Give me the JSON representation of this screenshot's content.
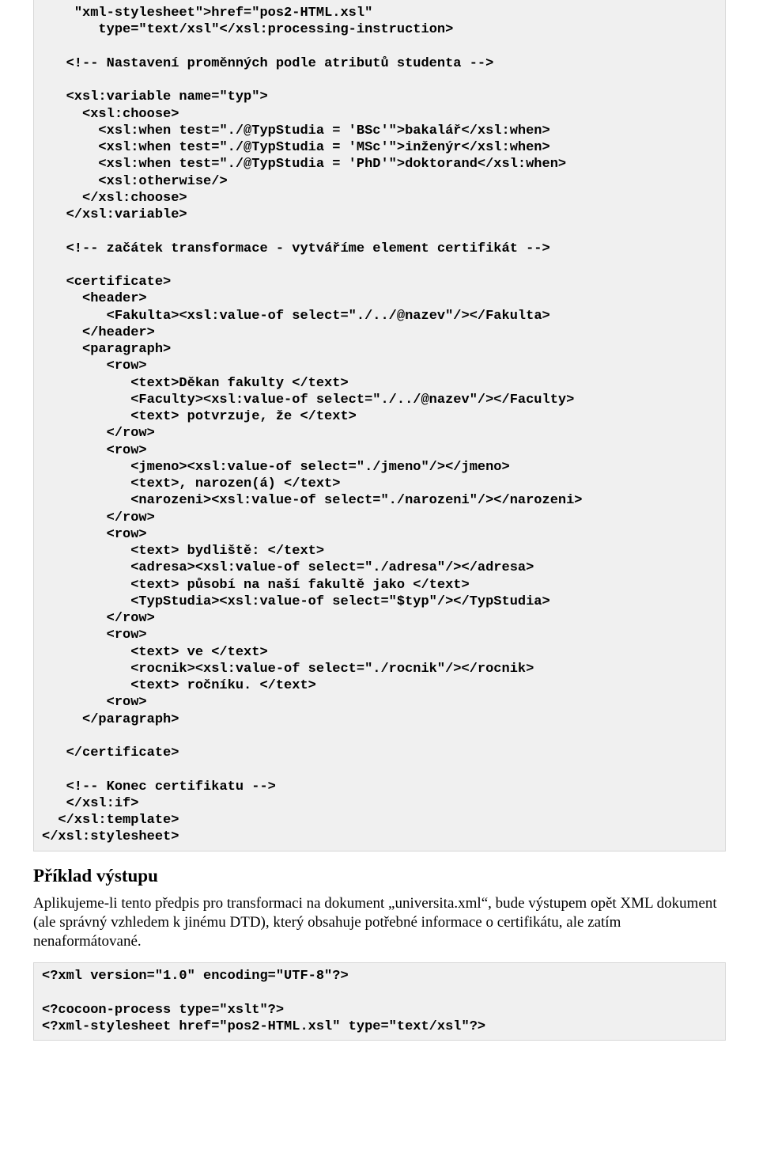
{
  "code1": "    \"xml-stylesheet\">href=\"pos2-HTML.xsl\"\n       type=\"text/xsl\"</xsl:processing-instruction>\n\n   <!-- Nastavení proměnných podle atributů studenta -->\n\n   <xsl:variable name=\"typ\">\n     <xsl:choose>\n       <xsl:when test=\"./@TypStudia = 'BSc'\">bakalář</xsl:when>\n       <xsl:when test=\"./@TypStudia = 'MSc'\">inženýr</xsl:when>\n       <xsl:when test=\"./@TypStudia = 'PhD'\">doktorand</xsl:when>\n       <xsl:otherwise/>\n     </xsl:choose>\n   </xsl:variable>\n\n   <!-- začátek transformace - vytváříme element certifikát -->\n\n   <certificate>\n     <header>\n        <Fakulta><xsl:value-of select=\"./../@nazev\"/></Fakulta>\n     </header>\n     <paragraph>\n        <row>\n           <text>Děkan fakulty </text>\n           <Faculty><xsl:value-of select=\"./../@nazev\"/></Faculty>\n           <text> potvrzuje, že </text>\n        </row>\n        <row>\n           <jmeno><xsl:value-of select=\"./jmeno\"/></jmeno>\n           <text>, narozen(á) </text>\n           <narozeni><xsl:value-of select=\"./narozeni\"/></narozeni>\n        </row>\n        <row>\n           <text> bydliště: </text>\n           <adresa><xsl:value-of select=\"./adresa\"/></adresa>\n           <text> působí na naší fakultě jako </text>\n           <TypStudia><xsl:value-of select=\"$typ\"/></TypStudia>\n        </row>\n        <row>\n           <text> ve </text>\n           <rocnik><xsl:value-of select=\"./rocnik\"/></rocnik>\n           <text> ročníku. </text>\n        <row>\n     </paragraph>\n\n   </certificate>\n\n   <!-- Konec certifikatu -->\n   </xsl:if>\n  </xsl:template>\n</xsl:stylesheet>",
  "heading": "Příklad výstupu",
  "paragraph": "Aplikujeme-li tento předpis pro transformaci na dokument „universita.xml“, bude výstupem opět XML dokument (ale správný vzhledem k jinému DTD), který obsahuje potřebné informace o certifikátu, ale zatím nenaformátované.",
  "code2": "<?xml version=\"1.0\" encoding=\"UTF-8\"?>\n\n<?cocoon-process type=\"xslt\"?>\n<?xml-stylesheet href=\"pos2-HTML.xsl\" type=\"text/xsl\"?>"
}
